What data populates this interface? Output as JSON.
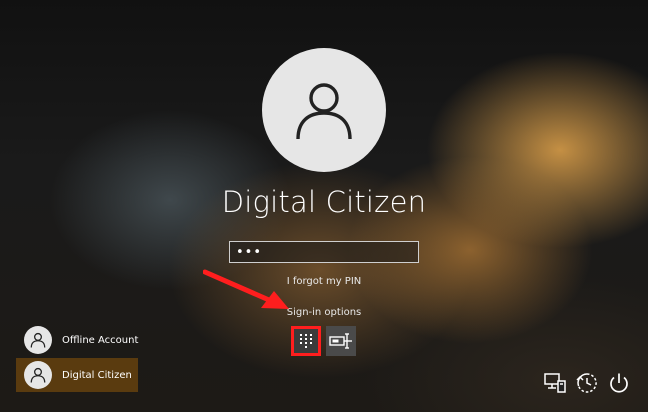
{
  "user": {
    "name": "Digital Citizen"
  },
  "pin": {
    "value": "•••"
  },
  "links": {
    "forgot": "I forgot my PIN",
    "signin_options": "Sign-in options"
  },
  "accounts": [
    {
      "label": "Offline Account",
      "selected": false
    },
    {
      "label": "Digital Citizen",
      "selected": true
    }
  ],
  "colors": {
    "highlight": "#ff1e1e",
    "selected_account": "#5f3e0f",
    "avatar": "#e6e6e6"
  },
  "icons": {
    "sign_in_options": [
      "pin-keypad-icon",
      "security-key-icon"
    ],
    "system": [
      "network-icon",
      "ease-of-access-icon",
      "power-icon"
    ]
  }
}
